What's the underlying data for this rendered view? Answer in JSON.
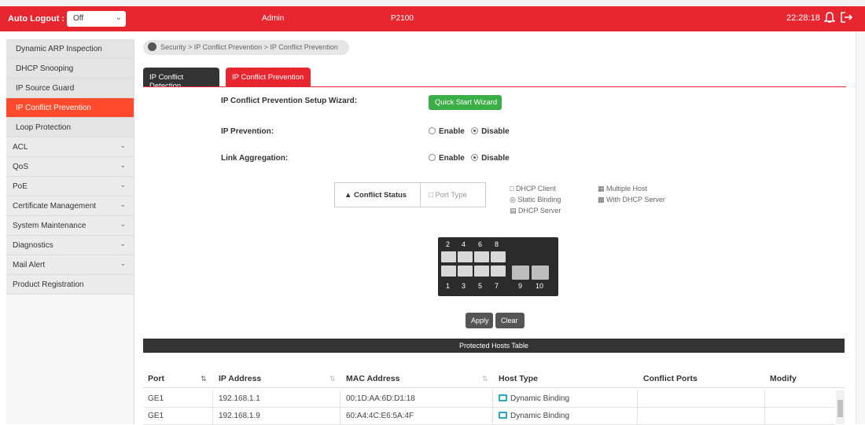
{
  "header": {
    "auto_logout_label": "Auto Logout :",
    "auto_logout_value": "Off",
    "user": "Admin",
    "model": "P2100",
    "clock": "22:28:18"
  },
  "sidebar": {
    "items": [
      {
        "label": "Dynamic ARP Inspection"
      },
      {
        "label": "DHCP Snooping"
      },
      {
        "label": "IP Source Guard"
      },
      {
        "label": "IP Conflict Prevention"
      },
      {
        "label": "Loop Protection"
      },
      {
        "label": "ACL"
      },
      {
        "label": "QoS"
      },
      {
        "label": "PoE"
      },
      {
        "label": "Certificate Management"
      },
      {
        "label": "System Maintenance"
      },
      {
        "label": "Diagnostics"
      },
      {
        "label": "Mail Alert"
      },
      {
        "label": "Product Registration"
      }
    ]
  },
  "breadcrumb": "Security > IP Conflict Prevention > IP Conflict Prevention",
  "tabs": [
    "IP Conflict Detection",
    "IP Conflict Prevention"
  ],
  "form": {
    "wizard_label": "IP Conflict Prevention Setup Wizard:",
    "wizard_button": "Quick Start Wizard",
    "ip_prevention_label": "IP Prevention:",
    "link_aggregation_label": "Link Aggregation:",
    "enable": "Enable",
    "disable": "Disable",
    "ip_prevention_value": "Disable",
    "link_aggregation_value": "Disable"
  },
  "legend": {
    "conflict_status": "Conflict Status",
    "port_type": "Port Type",
    "dhcp_client": "DHCP Client",
    "static_binding": "Static Binding",
    "dhcp_server": "DHCP Server",
    "multiple_host": "Multiple Host",
    "with_dhcp_server": "With DHCP Server"
  },
  "switch": {
    "top_numbers": [
      "2",
      "4",
      "6",
      "8"
    ],
    "bottom_numbers": [
      "1",
      "3",
      "5",
      "7",
      "9",
      "10"
    ]
  },
  "buttons": {
    "apply": "Apply",
    "clear": "Clear"
  },
  "table": {
    "title": "Protected Hosts Table",
    "headers": [
      "Port",
      "IP Address",
      "MAC Address",
      "Host Type",
      "Conflict Ports",
      "Modify"
    ],
    "rows": [
      {
        "port": "GE1",
        "ip": "192.168.1.1",
        "mac": "00:1D:AA:6D:D1:18",
        "host_type": "Dynamic Binding"
      },
      {
        "port": "GE1",
        "ip": "192.168.1.9",
        "mac": "60:A4:4C:E6:5A:4F",
        "host_type": "Dynamic Binding"
      }
    ]
  },
  "colors": {
    "accent": "#e8262f",
    "active": "#ff4b2b",
    "wizard": "#3cae47"
  }
}
